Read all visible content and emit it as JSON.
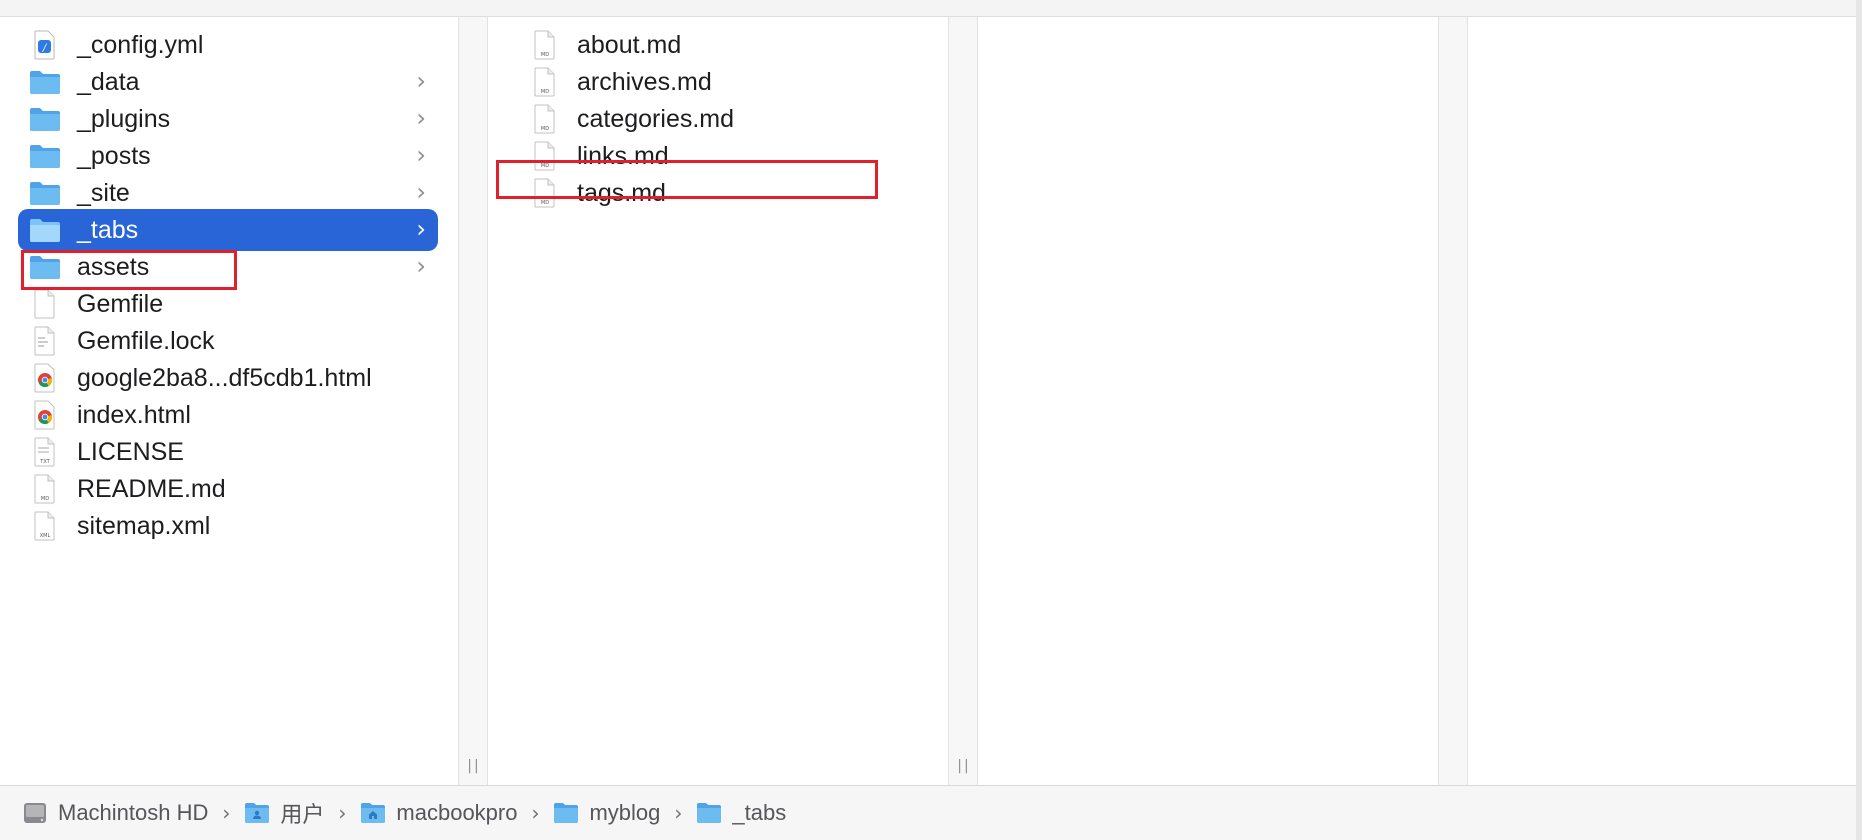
{
  "columns": {
    "root_items": [
      {
        "label": "_config.yml",
        "icon": "yml-file-icon",
        "folder": false
      },
      {
        "label": "_data",
        "icon": "folder-icon",
        "folder": true
      },
      {
        "label": "_plugins",
        "icon": "folder-icon",
        "folder": true
      },
      {
        "label": "_posts",
        "icon": "folder-icon",
        "folder": true
      },
      {
        "label": "_site",
        "icon": "folder-icon",
        "folder": true
      },
      {
        "label": "_tabs",
        "icon": "folder-icon",
        "folder": true,
        "selected": true
      },
      {
        "label": "assets",
        "icon": "folder-icon",
        "folder": true
      },
      {
        "label": "Gemfile",
        "icon": "blank-file-icon",
        "folder": false
      },
      {
        "label": "Gemfile.lock",
        "icon": "text-file-icon",
        "folder": false
      },
      {
        "label": "google2ba8...df5cdb1.html",
        "icon": "chrome-html-icon",
        "folder": false
      },
      {
        "label": "index.html",
        "icon": "chrome-html-icon",
        "folder": false
      },
      {
        "label": "LICENSE",
        "icon": "txt-file-icon",
        "folder": false
      },
      {
        "label": "README.md",
        "icon": "md-file-icon",
        "folder": false
      },
      {
        "label": "sitemap.xml",
        "icon": "xml-file-icon",
        "folder": false
      }
    ],
    "tabs_items": [
      {
        "label": "about.md",
        "icon": "md-file-icon"
      },
      {
        "label": "archives.md",
        "icon": "md-file-icon"
      },
      {
        "label": "categories.md",
        "icon": "md-file-icon"
      },
      {
        "label": "links.md",
        "icon": "md-file-icon",
        "highlighted": true
      },
      {
        "label": "tags.md",
        "icon": "md-file-icon"
      }
    ],
    "chevron": "›",
    "grip": "||"
  },
  "pathbar": {
    "crumbs": [
      {
        "label": "Machintosh HD",
        "icon": "hard-drive-icon"
      },
      {
        "label": "用户",
        "icon": "users-folder-icon"
      },
      {
        "label": "macbookpro",
        "icon": "home-folder-icon"
      },
      {
        "label": "myblog",
        "icon": "folder-icon"
      },
      {
        "label": "_tabs",
        "icon": "folder-icon"
      }
    ],
    "separator": "›"
  },
  "colors": {
    "selection": "#2a65d8",
    "highlight_box": "#e0202a",
    "folder": "#5aaeea"
  }
}
